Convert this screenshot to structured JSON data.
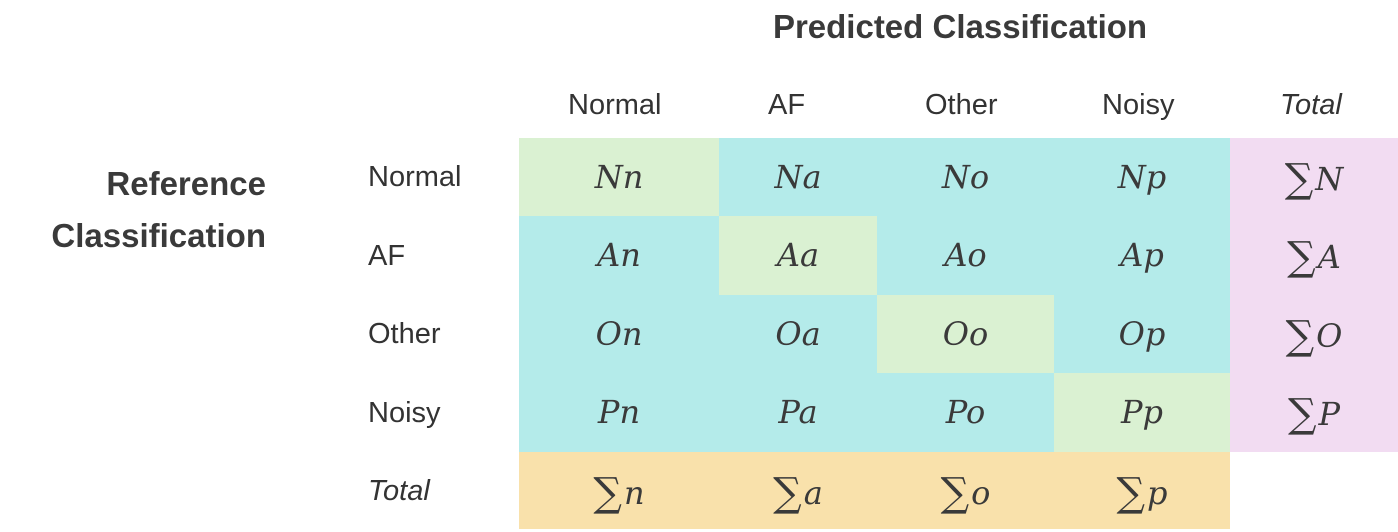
{
  "title": "Predicted Classification",
  "reference_label": [
    "Reference",
    "Classification"
  ],
  "columns": [
    "Normal",
    "AF",
    "Other",
    "Noisy",
    "Total"
  ],
  "rows": [
    "Normal",
    "AF",
    "Other",
    "Noisy",
    "Total"
  ],
  "cells": [
    [
      "Nn",
      "Na",
      "No",
      "Np"
    ],
    [
      "An",
      "Aa",
      "Ao",
      "Ap"
    ],
    [
      "On",
      "Oa",
      "Oo",
      "Op"
    ],
    [
      "Pn",
      "Pa",
      "Po",
      "Pp"
    ]
  ],
  "row_totals": [
    "N",
    "A",
    "O",
    "P"
  ],
  "col_totals": [
    "n",
    "a",
    "o",
    "p"
  ],
  "sigma": "∑",
  "colors": {
    "diagonal": "#daf1d2",
    "off_diagonal": "#b4ebea",
    "row_total": "#f2dcf2",
    "column_total": "#f9e1ab"
  }
}
